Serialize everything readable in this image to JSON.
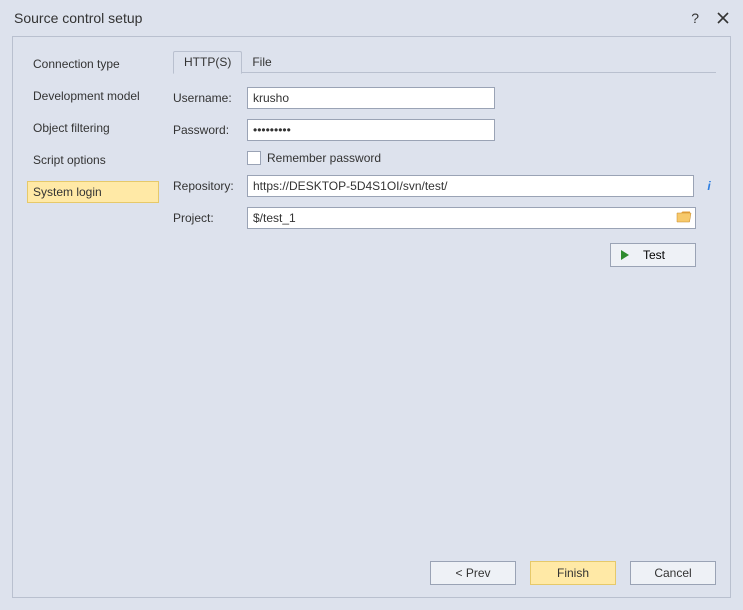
{
  "title": "Source control setup",
  "sidebar": {
    "items": [
      {
        "label": "Connection type"
      },
      {
        "label": "Development model"
      },
      {
        "label": "Object filtering"
      },
      {
        "label": "Script options"
      },
      {
        "label": "System login"
      }
    ]
  },
  "tabs": {
    "items": [
      {
        "label": "HTTP(S)"
      },
      {
        "label": "File"
      }
    ]
  },
  "form": {
    "username_label": "Username:",
    "username_value": "krusho",
    "password_label": "Password:",
    "password_value": "•••••••••",
    "remember_label": "Remember password",
    "repository_label": "Repository:",
    "repository_value": "https://DESKTOP-5D4S1OI/svn/test/",
    "project_label": "Project:",
    "project_value": "$/test_1",
    "test_label": "Test"
  },
  "buttons": {
    "prev": "< Prev",
    "finish": "Finish",
    "cancel": "Cancel"
  }
}
